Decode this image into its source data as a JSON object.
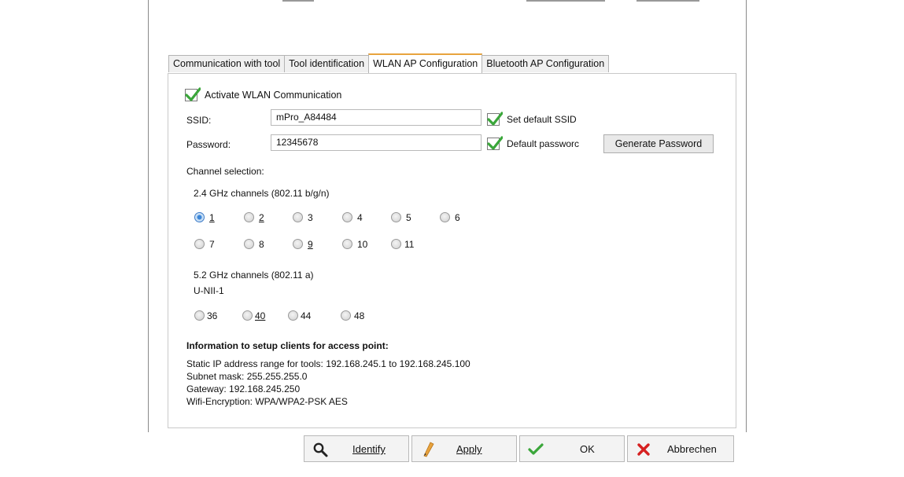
{
  "tabs": [
    {
      "label": "Communication with tool"
    },
    {
      "label": "Tool identification"
    },
    {
      "label": "WLAN AP Configuration"
    },
    {
      "label": "Bluetooth AP Configuration"
    }
  ],
  "wlan": {
    "activate_label": "Activate WLAN Communication",
    "activate_checked": true,
    "ssid_label": "SSID:",
    "ssid_value": "mPro_A84484",
    "set_default_ssid_label": "Set default SSID",
    "set_default_ssid_checked": true,
    "password_label": "Password:",
    "password_value": "12345678",
    "default_password_label": "Default passworc",
    "default_password_checked": true,
    "generate_password_label": "Generate Password"
  },
  "channels": {
    "selection_label": "Channel selection:",
    "band24_label": "2.4 GHz channels (802.11 b/g/n)",
    "band24_row1": [
      "1",
      "2",
      "3",
      "4",
      "5",
      "6"
    ],
    "band24_row2": [
      "7",
      "8",
      "9",
      "10",
      "11"
    ],
    "band52_label": "5.2 GHz channels (802.11 a)",
    "unii_label": "U-NII-1",
    "band52_row": [
      "36",
      "40",
      "44",
      "48"
    ],
    "selected": "1"
  },
  "info": {
    "heading": "Information to setup clients for access point:",
    "ip_range": "Static IP address range for tools: 192.168.245.1 to 192.168.245.100",
    "subnet": "Subnet mask: 255.255.255.0",
    "gateway": "Gateway: 192.168.245.250",
    "encryption": "Wifi-Encryption: WPA/WPA2-PSK AES"
  },
  "buttons": {
    "identify": "Identify",
    "apply": "Apply",
    "ok": "OK",
    "cancel": "Abbrechen"
  },
  "colors": {
    "active_tab_accent": "#e8a33d",
    "check_green": "#3aa63a",
    "cancel_red": "#d62020",
    "radio_selected": "#3c86d8"
  }
}
